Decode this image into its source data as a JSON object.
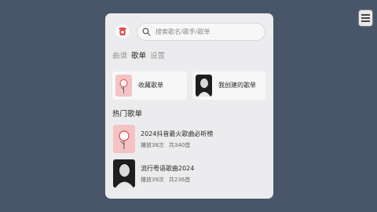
{
  "search": {
    "placeholder": "搜索歌名/歌手/歌单"
  },
  "tabs": [
    {
      "label": "曲谱",
      "active": false
    },
    {
      "label": "歌单",
      "active": true
    },
    {
      "label": "设置",
      "active": false
    }
  ],
  "cards": [
    {
      "label": "收藏歌单",
      "icon": "favorites-cover-icon"
    },
    {
      "label": "我创建的歌单",
      "icon": "artist-photo-thumbnail"
    }
  ],
  "hot": {
    "title": "热门歌单",
    "items": [
      {
        "title": "2024抖音最火歌曲必听榜",
        "plays": "播放38次",
        "count": "共340首",
        "icon": "playlist-cover-pink-icon"
      },
      {
        "title": "流行粤语歌曲2024",
        "plays": "播放39次",
        "count": "共236首",
        "icon": "artist-photo-thumbnail"
      }
    ]
  },
  "colors": {
    "background": "#49566a",
    "panel": "#ececee",
    "accent": "#e0454a",
    "cover_pink": "#f5c3c3"
  },
  "icons": {
    "logo": "app-logo-icon",
    "search": "search-icon",
    "menu": "hamburger-menu-icon"
  }
}
